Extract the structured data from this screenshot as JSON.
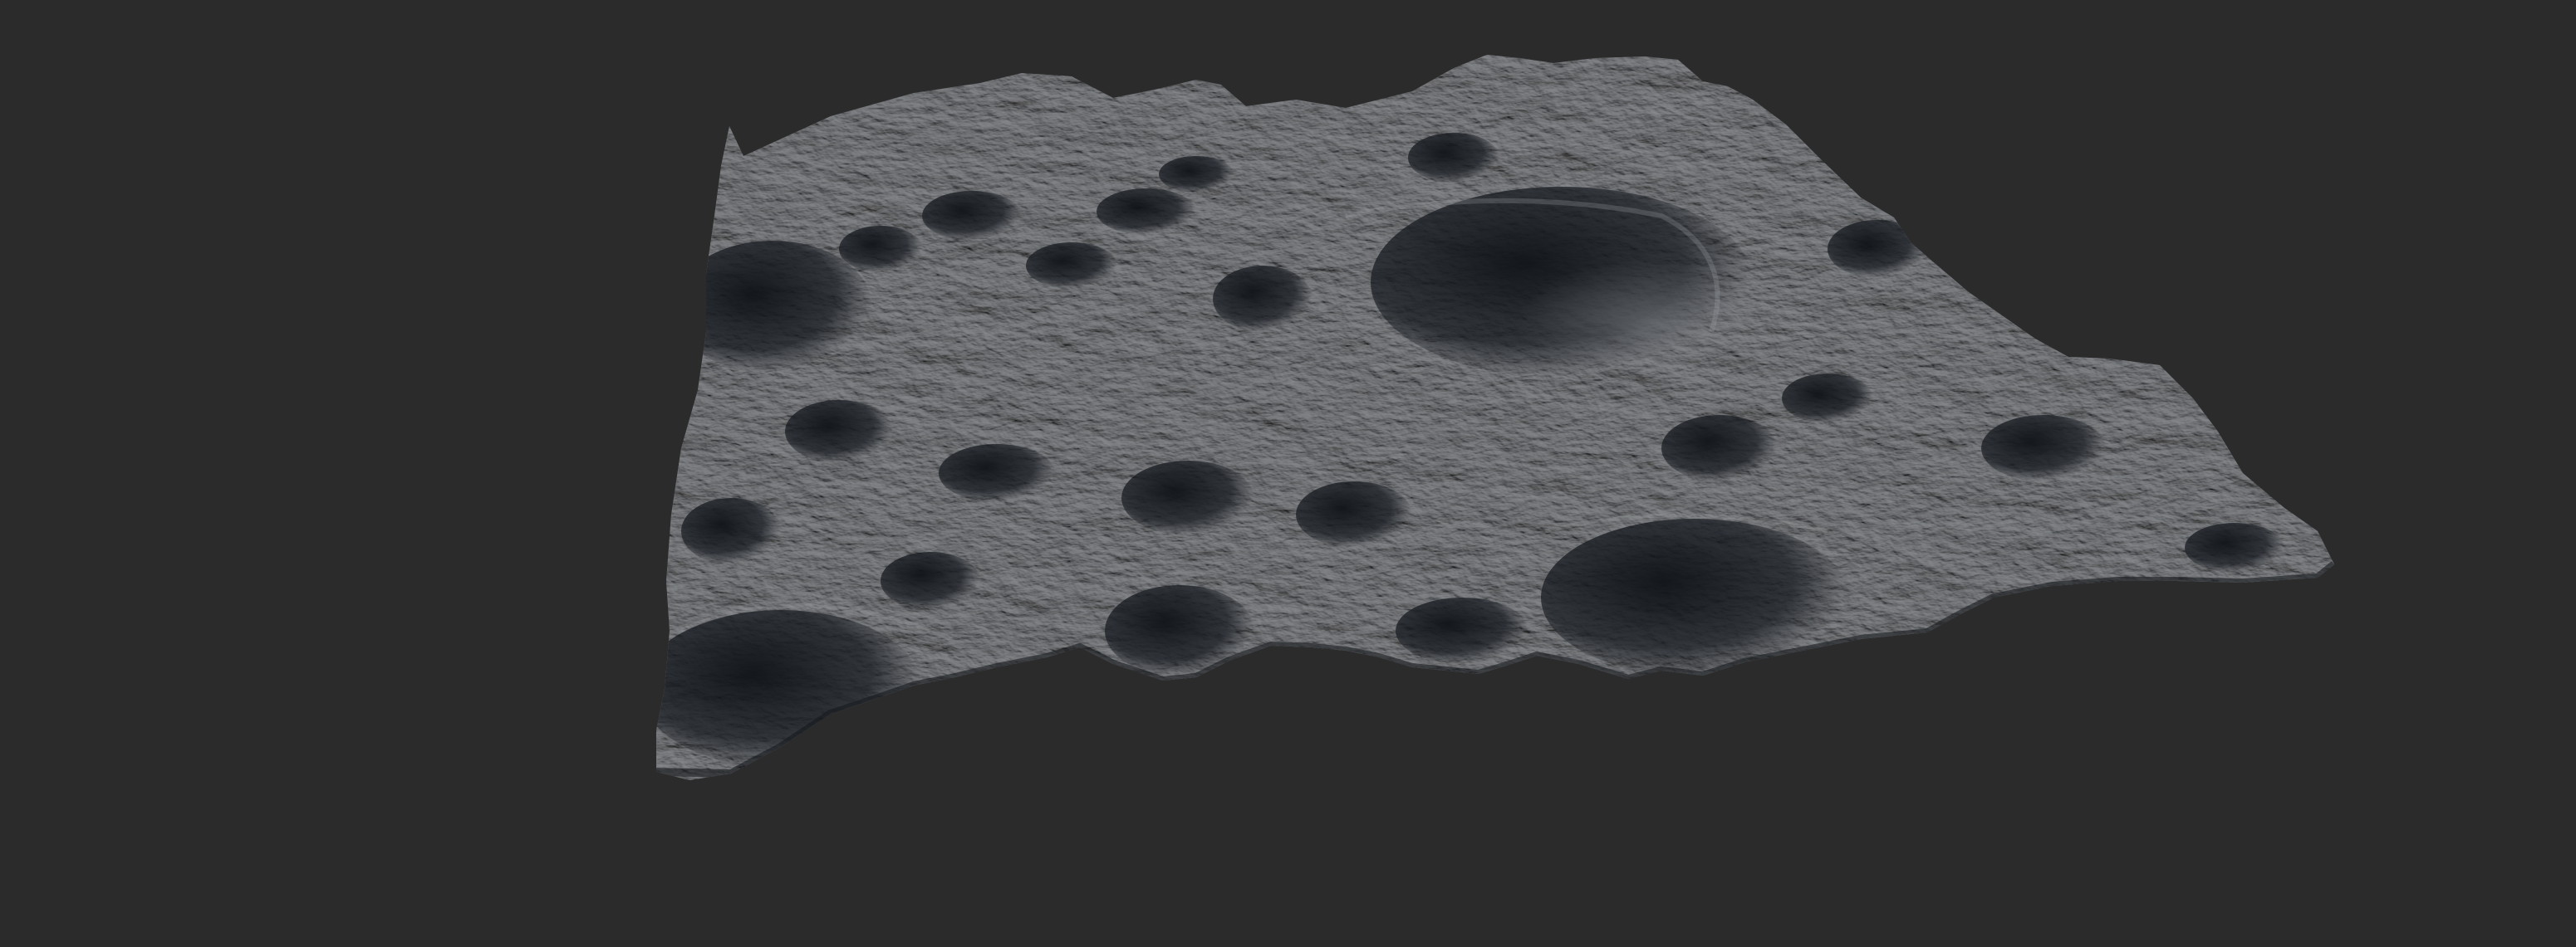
{
  "scene": {
    "subject": "lunar-terrain-heightmap-mesh",
    "colors": {
      "viewport_background": "#2b2b2b",
      "terrain_base": "#5a5d62",
      "terrain_highlight": "#9a9ca1",
      "crater_shadow": "#14171c",
      "rim_light": "#b8babd"
    }
  }
}
